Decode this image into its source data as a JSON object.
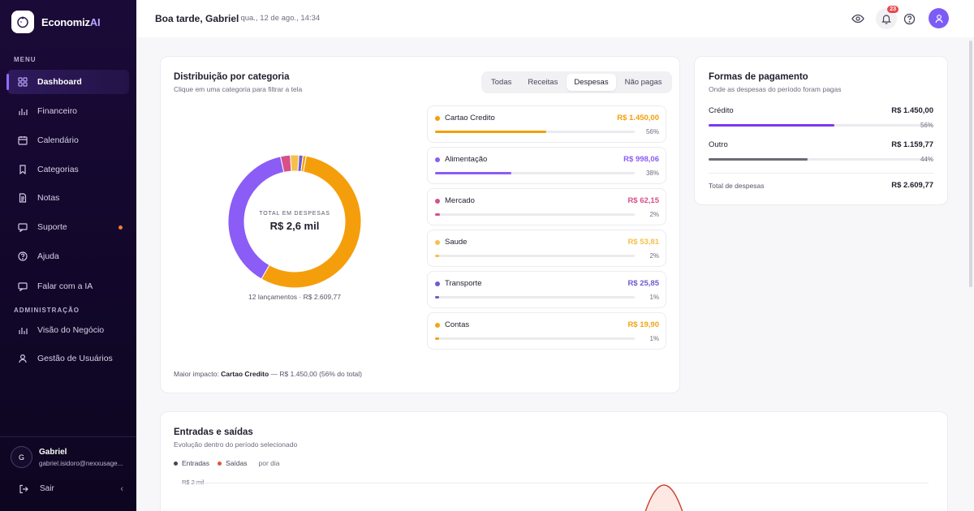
{
  "brand": {
    "name_main": "Economiz",
    "name_accent": "AI"
  },
  "sidebar": {
    "menu_label": "MENU",
    "admin_label": "ADMINISTRAÇÃO",
    "items": [
      {
        "label": "Dashboard",
        "icon": "grid-icon"
      },
      {
        "label": "Financeiro",
        "icon": "bar-chart-icon"
      },
      {
        "label": "Calendário",
        "icon": "calendar-icon"
      },
      {
        "label": "Categorias",
        "icon": "bookmark-icon"
      },
      {
        "label": "Notas",
        "icon": "document-icon"
      },
      {
        "label": "Suporte",
        "icon": "chat-icon"
      },
      {
        "label": "Ajuda",
        "icon": "help-icon"
      },
      {
        "label": "Falar com a IA",
        "icon": "chat-icon"
      }
    ],
    "admin_items": [
      {
        "label": "Visão do Negócio",
        "icon": "bar-chart-icon"
      },
      {
        "label": "Gestão de Usuários",
        "icon": "user-icon"
      }
    ],
    "user": {
      "initial": "G",
      "name": "Gabriel",
      "email": "gabriel.isidoro@nexxusage..."
    },
    "logout_label": "Sair"
  },
  "header": {
    "greeting": "Boa tarde, Gabriel",
    "date": "qua., 12 de ago., 14:34",
    "notification_count": "23"
  },
  "distribution": {
    "title": "Distribuição por categoria",
    "subtitle": "Clique em uma categoria para filtrar a tela",
    "filters": [
      "Todas",
      "Receitas",
      "Despesas",
      "Não pagas"
    ],
    "active_filter": "Despesas",
    "center_label": "TOTAL EM DESPESAS",
    "center_value": "R$ 2,6 mil",
    "caption": "12 lançamentos · R$ 2.609,77",
    "impact_prefix": "Maior impacto:",
    "impact_category": "Cartao Credito",
    "impact_suffix": "— R$ 1.450,00 (56% do total)",
    "categories": [
      {
        "name": "Cartao Credito",
        "value": "R$ 1.450,00",
        "pct": "56%",
        "share": 0.5556,
        "color": "#f59e0b"
      },
      {
        "name": "Alimentação",
        "value": "R$ 998,06",
        "pct": "38%",
        "share": 0.3824,
        "color": "#8b5cf6"
      },
      {
        "name": "Mercado",
        "value": "R$ 62,15",
        "pct": "2%",
        "share": 0.0238,
        "color": "#d6518a"
      },
      {
        "name": "Saude",
        "value": "R$ 53,81",
        "pct": "2%",
        "share": 0.0206,
        "color": "#f5c04a"
      },
      {
        "name": "Transporte",
        "value": "R$ 25,85",
        "pct": "1%",
        "share": 0.0099,
        "color": "#6d5bd0"
      },
      {
        "name": "Contas",
        "value": "R$ 19,90",
        "pct": "1%",
        "share": 0.0076,
        "color": "#f2a516"
      }
    ]
  },
  "payments": {
    "title": "Formas de pagamento",
    "subtitle": "Onde as despesas do período foram pagas",
    "rows": [
      {
        "label": "Crédito",
        "value": "R$ 1.450,00",
        "pct": "56%",
        "share": 0.56,
        "color": "#7c3aed"
      },
      {
        "label": "Outro",
        "value": "R$ 1.159,77",
        "pct": "44%",
        "share": 0.44,
        "color": "#6b6b78"
      }
    ],
    "total_label": "Total de despesas",
    "total_value": "R$ 2.609,77"
  },
  "flow": {
    "title": "Entradas e saídas",
    "subtitle": "Evolução dentro do período selecionado",
    "legend": [
      {
        "label": "Entradas",
        "color": "#444455"
      },
      {
        "label": "Saídas",
        "color": "#e0533d"
      }
    ],
    "granularity": "por dia",
    "axis_top_label": "R$ 2 mil"
  }
}
